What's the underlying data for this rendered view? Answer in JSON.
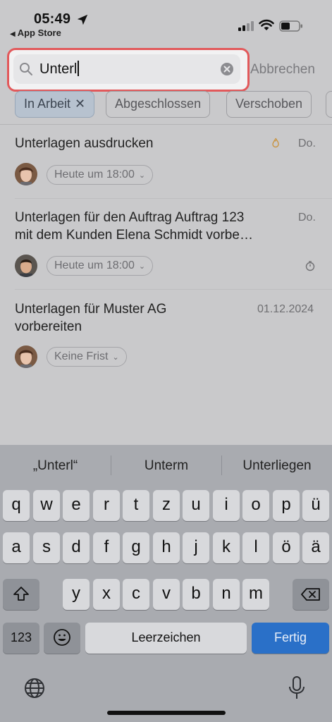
{
  "status": {
    "time": "05:49",
    "back_app": "App Store"
  },
  "search": {
    "value": "Unterl",
    "cancel_label": "Abbrechen"
  },
  "filters": [
    {
      "label": "In Arbeit",
      "active": true
    },
    {
      "label": "Abgeschlossen",
      "active": false
    },
    {
      "label": "Verschoben",
      "active": false
    }
  ],
  "tasks": [
    {
      "title_line1": "Unterlagen ausdrucken",
      "title_line2": "",
      "date": "Do.",
      "deadline": "Heute um 18:00",
      "icon": "flame-icon"
    },
    {
      "title_line1": "Unterlagen für den Auftrag Auftrag 123",
      "title_line2": "mit dem Kunden Elena  Schmidt vorbe…",
      "date": "Do.",
      "deadline": "Heute um 18:00",
      "icon": "timer-icon"
    },
    {
      "title_line1": "Unterlagen für Muster AG",
      "title_line2": "vorbereiten",
      "date": "01.12.2024",
      "deadline": "Keine Frist",
      "icon": ""
    }
  ],
  "keyboard": {
    "suggestions": [
      "„Unterl“",
      "Unterm",
      "Unterliegen"
    ],
    "row1": [
      "q",
      "w",
      "e",
      "r",
      "t",
      "z",
      "u",
      "i",
      "o",
      "p",
      "ü"
    ],
    "row2": [
      "a",
      "s",
      "d",
      "f",
      "g",
      "h",
      "j",
      "k",
      "l",
      "ö",
      "ä"
    ],
    "row3": [
      "y",
      "x",
      "c",
      "v",
      "b",
      "n",
      "m"
    ],
    "numbers_label": "123",
    "space_label": "Leerzeichen",
    "done_label": "Fertig"
  },
  "colors": {
    "accent": "#2a70c8",
    "highlight": "#e2595b"
  }
}
